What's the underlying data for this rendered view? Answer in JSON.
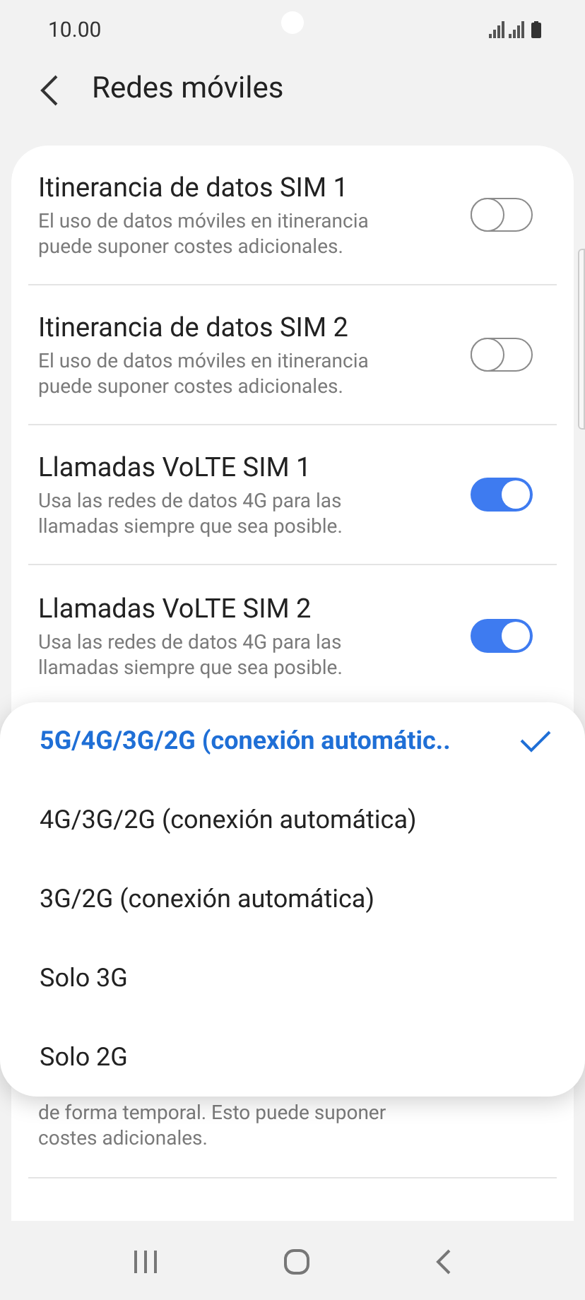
{
  "status_bar": {
    "time": "10.00"
  },
  "header": {
    "title": "Redes móviles"
  },
  "settings": [
    {
      "title": "Itinerancia de datos SIM 1",
      "description": "El uso de datos móviles en itinerancia puede suponer costes adicionales.",
      "on": false
    },
    {
      "title": "Itinerancia de datos SIM 2",
      "description": "El uso de datos móviles en itinerancia puede suponer costes adicionales.",
      "on": false
    },
    {
      "title": "Llamadas VoLTE SIM 1",
      "description": "Usa las redes de datos 4G para las llamadas siempre que sea posible.",
      "on": true
    },
    {
      "title": "Llamadas VoLTE SIM 2",
      "description": "Usa las redes de datos 4G para las llamadas siempre que sea posible.",
      "on": true
    }
  ],
  "covered_setting": {
    "description_lines": [
      "de forma temporal. Esto puede suponer",
      "costes adicionales."
    ]
  },
  "network_mode_menu": [
    {
      "label": "5G/4G/3G/2G (conexión automátic..",
      "selected": true
    },
    {
      "label": "4G/3G/2G (conexión automática)",
      "selected": false
    },
    {
      "label": "3G/2G (conexión automática)",
      "selected": false
    },
    {
      "label": "Solo 3G",
      "selected": false
    },
    {
      "label": "Solo 2G",
      "selected": false
    }
  ]
}
